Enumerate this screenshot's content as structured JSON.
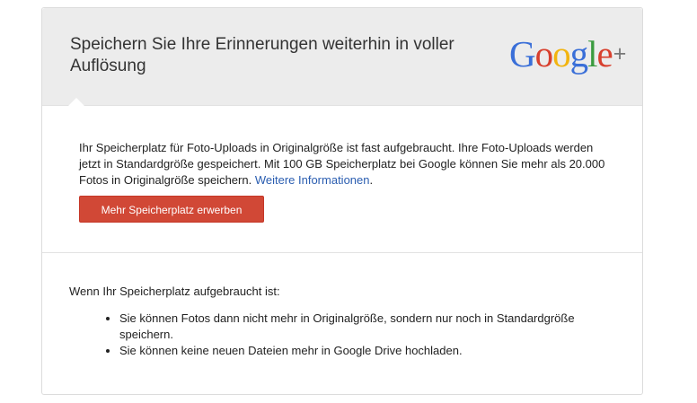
{
  "header": {
    "title": "Speichern Sie Ihre Erinnerungen weiterhin in voller Auflösung",
    "logo": {
      "letters": [
        "G",
        "o",
        "o",
        "g",
        "l",
        "e"
      ],
      "plus": "+",
      "colors": {
        "blue": "#3a6fd8",
        "red": "#d8402e",
        "yellow": "#f2b40f",
        "green": "#3a9b3f"
      }
    }
  },
  "info": {
    "text": "Ihr Speicherplatz für Foto-Uploads in Originalgröße ist fast aufgebraucht. Ihre Foto-Uploads werden jetzt in Standardgröße gespeichert. Mit 100 GB Speicherplatz bei Google können Sie mehr als 20.000 Fotos in Originalgröße speichern.",
    "link_label": "Weitere Informationen",
    "trailing": ".",
    "link_color": "#2a5db0"
  },
  "button": {
    "label": "Mehr Speicherplatz erwerben",
    "color": "#d14836"
  },
  "consequences": {
    "heading": "Wenn Ihr Speicherplatz aufgebraucht ist:",
    "items": [
      "Sie können Fotos dann nicht mehr in Originalgröße, sondern nur noch in Standardgröße speichern.",
      "Sie können keine neuen Dateien mehr in Google Drive hochladen."
    ]
  }
}
